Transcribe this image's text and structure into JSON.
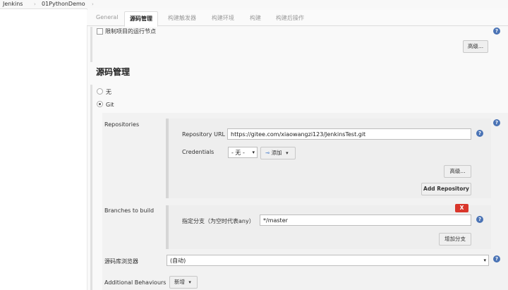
{
  "breadcrumb": {
    "root": "Jenkins",
    "sep1": "›",
    "project": "01PythonDemo",
    "sep2": "›"
  },
  "tabs": [
    "General",
    "源码管理",
    "构建触发器",
    "构建环境",
    "构建",
    "构建后操作"
  ],
  "restrict_node": {
    "label": "限制项目的运行节点",
    "checked": false
  },
  "advanced_top_label": "高级...",
  "section_title": "源码管理",
  "scm_options": {
    "none": "无",
    "git": "Git",
    "selected": "git"
  },
  "repositories": {
    "label": "Repositories",
    "url_label": "Repository URL",
    "url_value": "https://gitee.com/xiaowangzi123/JenkinsTest.git",
    "credentials_label": "Credentials",
    "credentials_value": "- 无 -",
    "add_label": "添加",
    "advanced_label": "高级...",
    "add_repo_label": "Add Repository"
  },
  "branches": {
    "label": "Branches to build",
    "delete_label": "X",
    "spec_label": "指定分支（为空时代表any）",
    "spec_value": "*/master",
    "add_branch_label": "增加分支"
  },
  "repo_browser": {
    "label": "源码库浏览器",
    "value": "(自动)"
  },
  "additional_behaviours": {
    "label": "Additional Behaviours",
    "add_label": "新增"
  },
  "colors": {
    "help": "#4a73b5",
    "delete": "#d9362b",
    "key": "#5b8bd0"
  }
}
